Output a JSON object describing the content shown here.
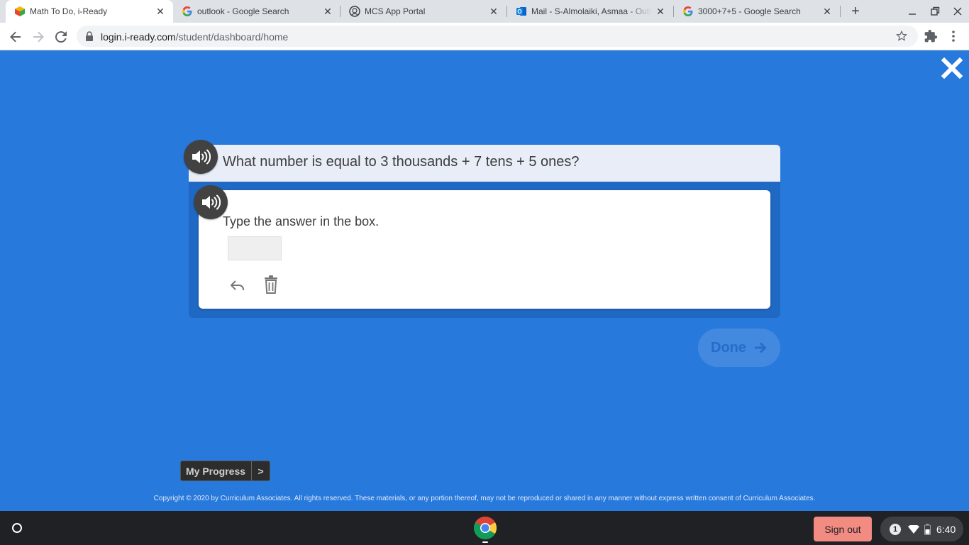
{
  "browser": {
    "tabs": [
      {
        "title": "Math To Do, i-Ready",
        "active": true
      },
      {
        "title": "outlook - Google Search",
        "active": false
      },
      {
        "title": "MCS App Portal",
        "active": false
      },
      {
        "title": "Mail - S-Almolaiki, Asmaa - Outlo",
        "active": false
      },
      {
        "title": "3000+7+5 - Google Search",
        "active": false
      }
    ],
    "url": {
      "host": "login.i-ready.com",
      "path": "/student/dashboard/home"
    },
    "icons": {
      "back": "back-arrow-icon",
      "forward": "forward-arrow-icon",
      "reload": "reload-icon",
      "lock": "lock-icon",
      "bookmark": "star-icon",
      "extensions": "puzzle-icon",
      "menu": "three-dots-icon"
    }
  },
  "lesson": {
    "question": "What number is equal to 3 thousands + 7 tens + 5 ones?",
    "instruction": "Type the answer in the box.",
    "answer_value": "",
    "done_label": "Done",
    "progress_label": "My Progress",
    "progress_arrow": ">",
    "copyright": "Copyright © 2020 by Curriculum Associates. All rights reserved. These materials, or any portion thereof, may not be reproduced or shared in any manner without express written consent of Curriculum Associates."
  },
  "shelf": {
    "signout_label": "Sign out",
    "notification_count": "1",
    "time": "6:40"
  },
  "colors": {
    "page_bg": "#2779dc",
    "panel_bg": "#1f69c4",
    "question_bar": "#e8edf7",
    "signout": "#f28b82"
  }
}
